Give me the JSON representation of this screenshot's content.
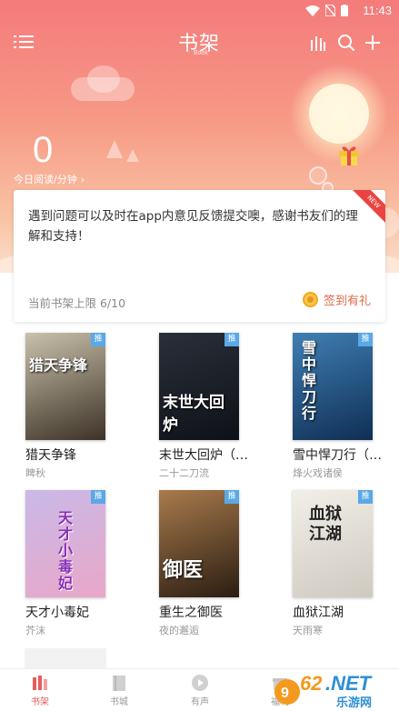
{
  "status_bar": {
    "time": "11:43"
  },
  "header": {
    "title": "书架",
    "subtitle": "Book"
  },
  "reading": {
    "count": "0",
    "label": "今日阅读/分钟",
    "arrow": "›"
  },
  "notice": {
    "text": "遇到问题可以及时在app内意见反馈提交噢，感谢书友们的理解和支持！",
    "limit": "当前书架上限 6/10",
    "checkin_label": "签到有礼",
    "new_badge": "NEW"
  },
  "books": [
    {
      "name": "猎天争锋",
      "author": "睥秋",
      "cover_text": "猎天争锋",
      "tag": "推",
      "cover_colors": [
        "#c9c1ac",
        "#3d3226"
      ]
    },
    {
      "name": "末世大回炉（…",
      "author": "二十二刀流",
      "cover_text": "末世大回炉",
      "tag": "推",
      "cover_colors": [
        "#2a2f3a",
        "#0e1117"
      ]
    },
    {
      "name": "雪中悍刀行（…",
      "author": "烽火戏诸侯",
      "cover_text": "雪中悍刀行",
      "tag": "推",
      "cover_colors": [
        "#3f7fb3",
        "#0f2f55"
      ]
    },
    {
      "name": "天才小毒妃",
      "author": "芥沫",
      "cover_text": "天才小毒妃",
      "tag": "推",
      "cover_colors": [
        "#c9b9e8",
        "#e9a7c8"
      ]
    },
    {
      "name": "重生之御医",
      "author": "夜的邂逅",
      "cover_text": "御医",
      "tag": "推",
      "cover_colors": [
        "#a87b4c",
        "#2b1d12"
      ]
    },
    {
      "name": "血狱江湖",
      "author": "天雨寒",
      "cover_text": "血狱江湖",
      "tag": "推",
      "cover_colors": [
        "#f1efe8",
        "#cfcac0"
      ]
    }
  ],
  "nav": [
    {
      "label": "书架",
      "icon": "bookshelf-icon",
      "active": true
    },
    {
      "label": "书城",
      "icon": "bookstore-icon",
      "active": false
    },
    {
      "label": "有声",
      "icon": "audio-play-icon",
      "active": false
    },
    {
      "label": "福利",
      "icon": "welfare-icon",
      "active": false
    }
  ],
  "watermark": {
    "text": "962.NET",
    "sub": "乐游网"
  },
  "colors": {
    "accent": "#e95b5b",
    "hero_top": "#f47b7b",
    "hero_bottom": "#fbe0cc",
    "tag": "#5aa9e6"
  }
}
